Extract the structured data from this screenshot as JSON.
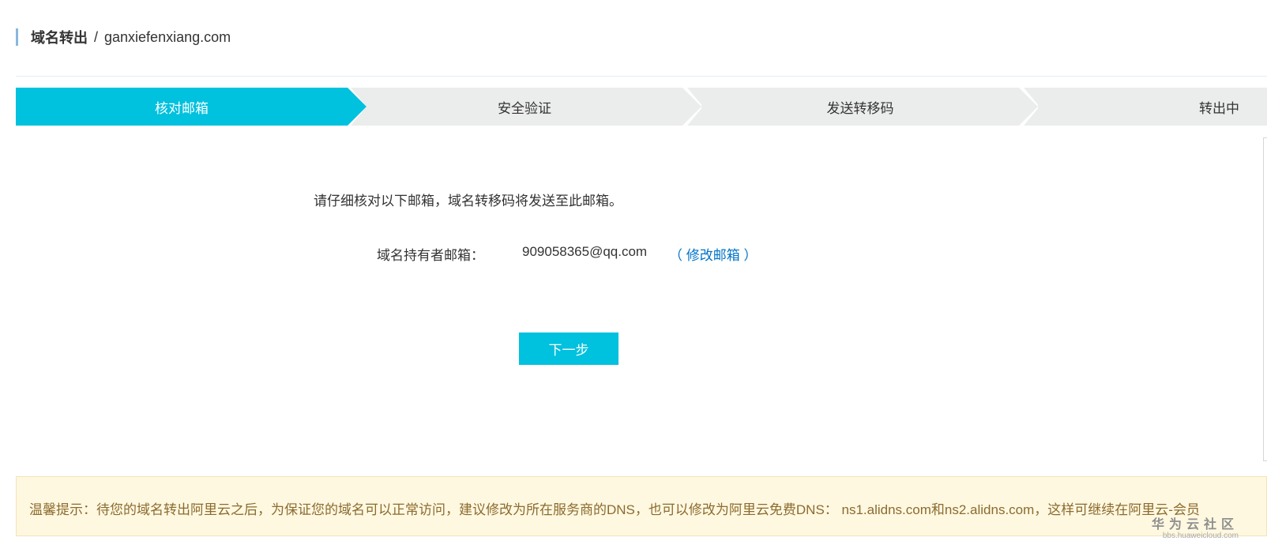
{
  "header": {
    "title_main": "域名转出",
    "separator": "/",
    "domain": "ganxiefenxiang.com"
  },
  "steps": [
    {
      "label": "核对邮箱",
      "active": true
    },
    {
      "label": "安全验证",
      "active": false
    },
    {
      "label": "发送转移码",
      "active": false
    },
    {
      "label": "转出中",
      "active": false
    }
  ],
  "colors": {
    "accent": "#00c1de",
    "step_inactive": "#ebedec",
    "link": "#0073c8",
    "tip_bg": "#fff8e1",
    "tip_text": "#8b6b2e"
  },
  "content": {
    "notice": "请仔细核对以下邮箱，域名转移码将发送至此邮箱。",
    "email_label": "域名持有者邮箱：",
    "email_value": "909058365@qq.com",
    "modify_link": "（ 修改邮箱 ）",
    "next_button": "下一步"
  },
  "tip": {
    "text": "温馨提示：待您的域名转出阿里云之后，为保证您的域名可以正常访问，建议修改为所在服务商的DNS，也可以修改为阿里云免费DNS： ns1.alidns.com和ns2.alidns.com，这样可继续在阿里云-会员"
  },
  "watermark": {
    "main": "华为云社区",
    "sub": "bbs.huaweicloud.com"
  }
}
